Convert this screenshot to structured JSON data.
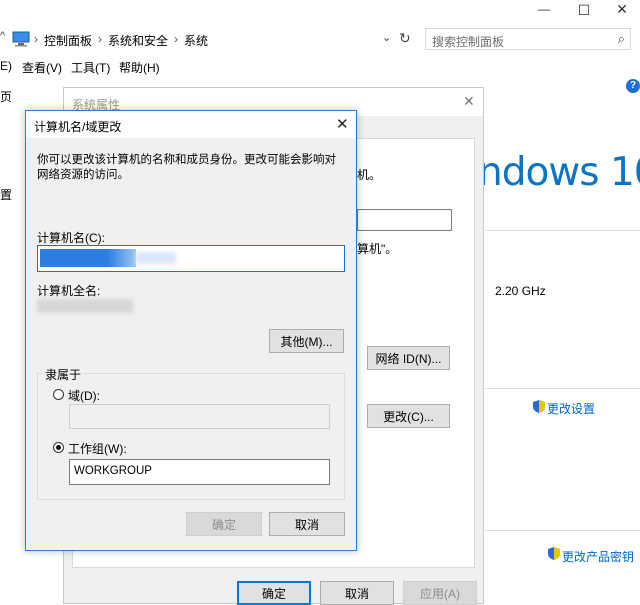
{
  "window_controls": {
    "minimize": "—",
    "maximize": "☐",
    "close": "✕"
  },
  "address_bar": {
    "crumbs": [
      "控制面板",
      "系统和安全",
      "系统"
    ],
    "separator": "›",
    "search_placeholder": "搜索控制面板"
  },
  "menu": {
    "items": [
      "E)",
      "查看(V)",
      "工具(T)",
      "帮助(H)"
    ]
  },
  "left_partial": {
    "t1": "页",
    "t2": "置"
  },
  "background": {
    "windows_text": "ndows 10",
    "partial_text_1": "机。",
    "partial_text_2": "算机\"。",
    "cpu_speed": "2.20 GHz",
    "change_settings": "更改设置",
    "change_key": "更改产品密钥"
  },
  "sysprops": {
    "title": "系统属性",
    "network_id_button": "网络 ID(N)...",
    "change_button": "更改(C)...",
    "ok": "确定",
    "cancel": "取消",
    "apply": "应用(A)"
  },
  "dialog": {
    "title": "计算机名/域更改",
    "description": "你可以更改该计算机的名称和成员身份。更改可能会影响对网络资源的访问。",
    "computer_name_label": "计算机名(C):",
    "full_name_label": "计算机全名:",
    "more_button": "其他(M)...",
    "member_of": "隶属于",
    "domain_label": "域(D):",
    "workgroup_label": "工作组(W):",
    "workgroup_value": "WORKGROUP",
    "ok": "确定",
    "cancel": "取消"
  },
  "colors": {
    "accent": "#0078d7",
    "link": "#0066cc",
    "windows_blue": "#0a74c9"
  }
}
